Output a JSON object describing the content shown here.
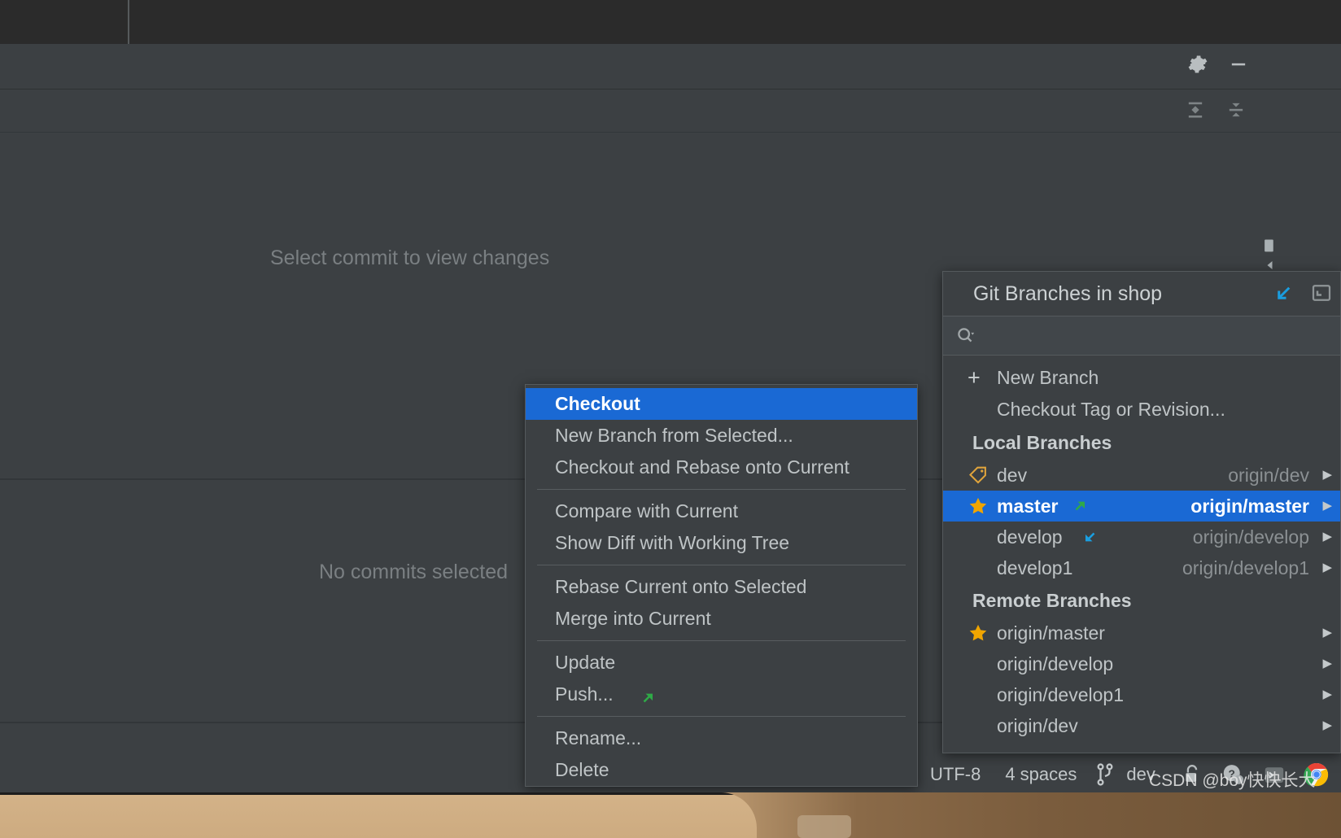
{
  "window": {
    "placeholders": {
      "select_commit": "Select commit to view changes",
      "no_commits": "No commits selected"
    },
    "toolbar_icons": {
      "settings": "gear-icon",
      "minimize": "minimize-icon",
      "expand_all": "expand-all-icon",
      "collapse_all": "collapse-all-icon"
    }
  },
  "context_menu": {
    "items": [
      {
        "label": "Checkout",
        "selected": true,
        "separator_after": false
      },
      {
        "label": "New Branch from Selected...",
        "selected": false,
        "separator_after": false
      },
      {
        "label": "Checkout and Rebase onto Current",
        "selected": false,
        "separator_after": true
      },
      {
        "label": "Compare with Current",
        "selected": false,
        "separator_after": false
      },
      {
        "label": "Show Diff with Working Tree",
        "selected": false,
        "separator_after": true
      },
      {
        "label": "Rebase Current onto Selected",
        "selected": false,
        "separator_after": false
      },
      {
        "label": "Merge into Current",
        "selected": false,
        "separator_after": true
      },
      {
        "label": "Update",
        "selected": false,
        "separator_after": false
      },
      {
        "label": "Push...",
        "selected": false,
        "separator_after": true,
        "icon": "push-arrow-icon"
      },
      {
        "label": "Rename...",
        "selected": false,
        "separator_after": false
      },
      {
        "label": "Delete",
        "selected": false,
        "separator_after": false
      }
    ]
  },
  "git_popup": {
    "title": "Git Branches in shop",
    "header_icons": [
      "checkout-arrow-icon",
      "restore-window-icon"
    ],
    "search": {
      "value": "",
      "placeholder": "",
      "icon": "search-icon"
    },
    "actions": [
      {
        "label": "New Branch",
        "icon": "plus-icon"
      },
      {
        "label": "Checkout Tag or Revision...",
        "icon": ""
      }
    ],
    "sections": [
      {
        "title": "Local Branches",
        "branches": [
          {
            "name": "dev",
            "icon": "tag-icon",
            "track_arrow": "",
            "tracking": "origin/dev",
            "selected": false,
            "chevron": "▶"
          },
          {
            "name": "master",
            "icon": "star-icon",
            "track_arrow": "arrow-up-right-icon",
            "tracking": "origin/master",
            "selected": true,
            "chevron": "▶"
          },
          {
            "name": "develop",
            "icon": "",
            "track_arrow": "arrow-down-left-icon",
            "tracking": "origin/develop",
            "selected": false,
            "chevron": "▶"
          },
          {
            "name": "develop1",
            "icon": "",
            "track_arrow": "",
            "tracking": "origin/develop1",
            "selected": false,
            "chevron": "▶"
          }
        ]
      },
      {
        "title": "Remote Branches",
        "branches": [
          {
            "name": "origin/master",
            "icon": "star-icon",
            "track_arrow": "",
            "tracking": "",
            "selected": false,
            "chevron": "▶"
          },
          {
            "name": "origin/develop",
            "icon": "",
            "track_arrow": "",
            "tracking": "",
            "selected": false,
            "chevron": "▶"
          },
          {
            "name": "origin/develop1",
            "icon": "",
            "track_arrow": "",
            "tracking": "",
            "selected": false,
            "chevron": "▶"
          },
          {
            "name": "origin/dev",
            "icon": "",
            "track_arrow": "",
            "tracking": "",
            "selected": false,
            "chevron": "▶"
          }
        ]
      }
    ]
  },
  "status_bar": {
    "encoding": "UTF-8",
    "indent": "4 spaces",
    "branch": "dev",
    "branch_icon": "git-branch-icon",
    "icons": [
      "lock-icon",
      "help-icon",
      "terminal-icon",
      "chrome-icon"
    ]
  },
  "watermark": "CSDN @boy快快长大",
  "colors": {
    "accent_selection": "#1a69d4",
    "panel_bg": "#3c4043",
    "star_gold": "#f0a500",
    "arrow_green": "#3cb14a",
    "arrow_blue": "#1a9ee0",
    "text": "#bfc4c6"
  }
}
